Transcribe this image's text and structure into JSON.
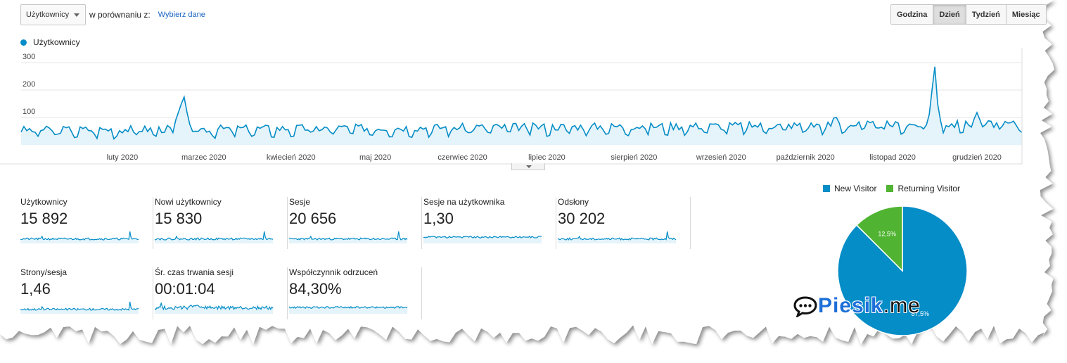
{
  "toolbar": {
    "metric_select": "Użytkownicy",
    "compare_label": "w porównaniu z:",
    "choose_link": "Wybierz dane"
  },
  "granularity": {
    "buttons": [
      "Godzina",
      "Dzień",
      "Tydzień",
      "Miesiąc"
    ],
    "active": "Dzień"
  },
  "chart_data": {
    "type": "area",
    "series": [
      {
        "name": "Użytkownicy"
      }
    ],
    "yticks": [
      "300",
      "200",
      "100"
    ],
    "ylim": [
      0,
      330
    ],
    "months": [
      "luty 2020",
      "marzec 2020",
      "kwiecień 2020",
      "maj 2020",
      "czerwiec 2020",
      "lipiec 2020",
      "sierpień 2020",
      "wrzesień 2020",
      "październik 2020",
      "listopad 2020",
      "grudzień 2020"
    ],
    "x_range": [
      "2020-01-10",
      "2020-12-31"
    ],
    "approx_values": [
      {
        "x": "2020-01-10",
        "y": 45
      },
      {
        "x": "2020-03-11",
        "y": 175
      },
      {
        "x": "2020-03-13",
        "y": 75
      },
      {
        "x": "2020-06-01",
        "y": 60
      },
      {
        "x": "2020-09-01",
        "y": 55
      },
      {
        "x": "2020-10-26",
        "y": 100
      },
      {
        "x": "2020-11-30",
        "y": 285
      },
      {
        "x": "2020-12-03",
        "y": 55
      },
      {
        "x": "2020-12-15",
        "y": 120
      },
      {
        "x": "2020-12-31",
        "y": 70
      }
    ],
    "grid": true,
    "color": "#058dc7",
    "fill": "#e5f3fa"
  },
  "metrics": [
    {
      "label": "Użytkownicy",
      "value": "15 892"
    },
    {
      "label": "Nowi użytkownicy",
      "value": "15 830"
    },
    {
      "label": "Sesje",
      "value": "20 656"
    },
    {
      "label": "Sesje na użytkownika",
      "value": "1,30"
    },
    {
      "label": "Odsłony",
      "value": "30 202"
    },
    {
      "label": "Strony/sesja",
      "value": "1,46"
    },
    {
      "label": "Śr. czas trwania sesji",
      "value": "00:01:04"
    },
    {
      "label": "Współczynnik odrzuceń",
      "value": "84,30%"
    }
  ],
  "pie": {
    "type": "pie",
    "slices": [
      {
        "name": "New Visitor",
        "value": 87.5,
        "label": "87,5%",
        "color": "#058dc7"
      },
      {
        "name": "Returning Visitor",
        "value": 12.5,
        "label": "12,5%",
        "color": "#50b432"
      }
    ]
  },
  "watermark": {
    "brand": "Piesik",
    "suffix": ".me",
    "icon": "chat-bubble-icon"
  }
}
